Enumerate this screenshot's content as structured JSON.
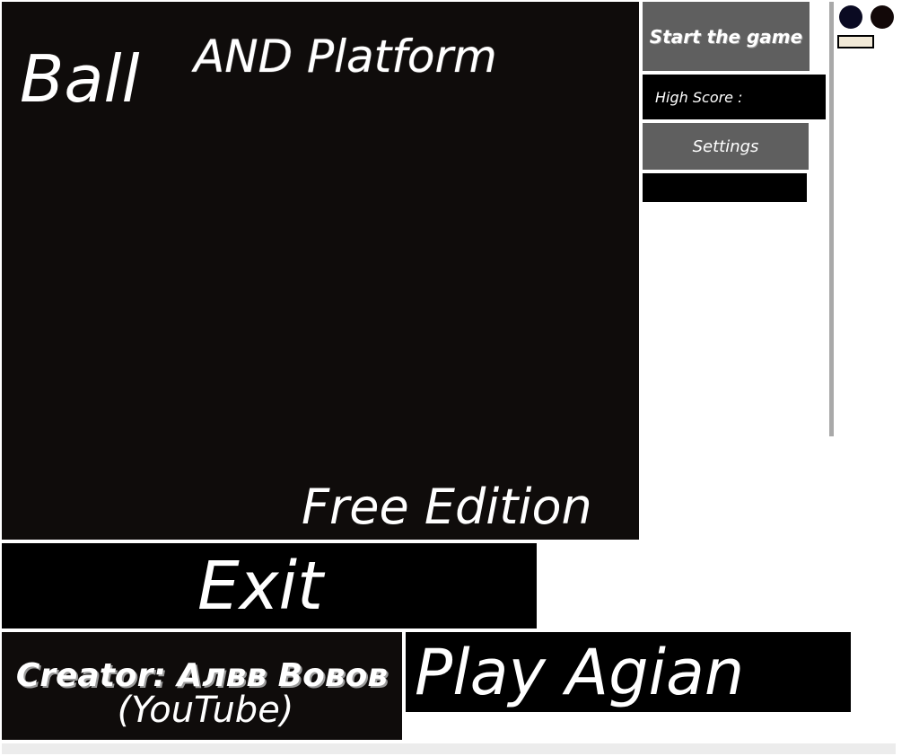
{
  "title": {
    "ball": "Ball",
    "and_platform": "AND Platform",
    "edition": "Free Edition"
  },
  "menu": {
    "start_label": "Start the game",
    "high_score_label": "High Score :",
    "settings_label": "Settings"
  },
  "bottom": {
    "exit_label": "Exit",
    "creator_line1": "Creator: Алвв Вовов",
    "creator_line2": "(YouTube)",
    "play_again_label": "Play Agian"
  },
  "colors": {
    "panel": "#0f0c0b",
    "button_gray": "#5f5f5f",
    "divider": "#a9a9a9"
  }
}
